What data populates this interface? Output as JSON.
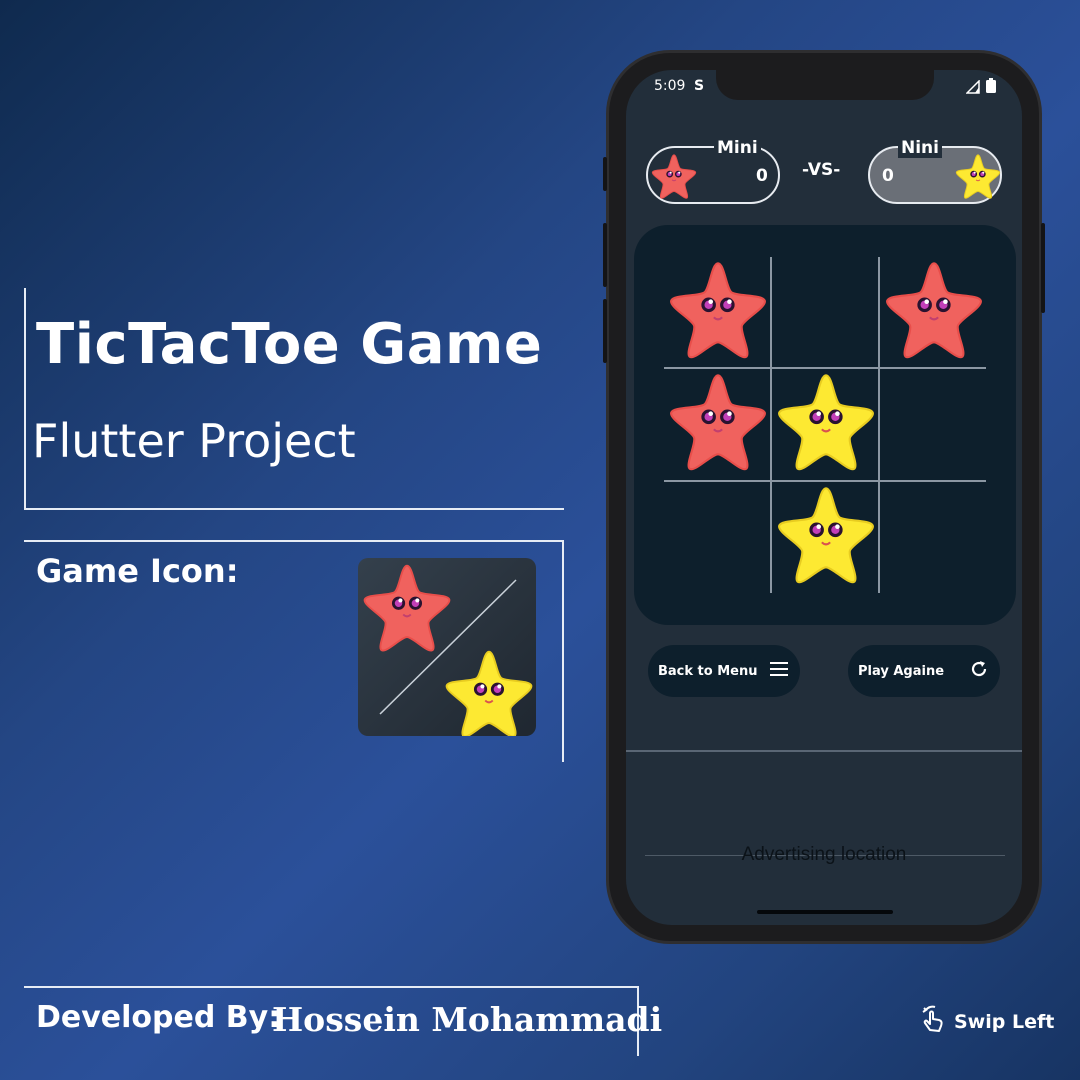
{
  "headline": {
    "title": "TicTacToe Game",
    "subtitle": "Flutter Project",
    "icon_label": "Game Icon:"
  },
  "credit": {
    "label": "Developed By:",
    "name": "Hossein Mohammadi"
  },
  "swipe_hint": "Swip Left",
  "phone": {
    "status_time": "5:09",
    "status_app_glyph": "S",
    "player1": {
      "name": "Mini",
      "score": "0",
      "piece": "red-star"
    },
    "player2": {
      "name": "Nini",
      "score": "0",
      "piece": "yellow-star"
    },
    "vs_label": "-VS-",
    "board": [
      [
        "red",
        "",
        "red"
      ],
      [
        "red",
        "yellow",
        ""
      ],
      [
        "",
        "yellow",
        ""
      ]
    ],
    "back_button": "Back to Menu",
    "play_button": "Play Againe",
    "ad_text": "Advertising location"
  },
  "colors": {
    "red_star": "#f0625e",
    "yellow_star": "#fde932",
    "board_bg": "#0d1f2c",
    "screen_bg": "#222e3a"
  }
}
